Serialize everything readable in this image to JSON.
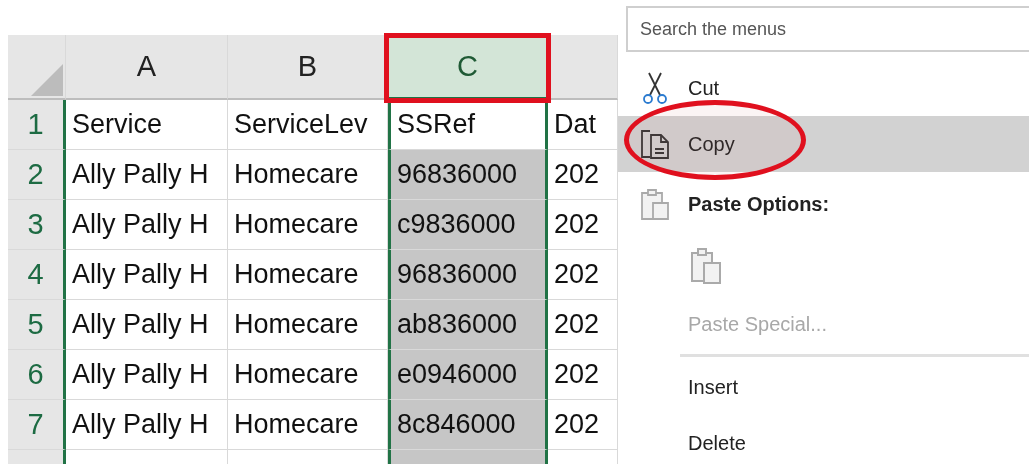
{
  "sheet": {
    "columns": [
      {
        "letter": "A",
        "selected": false
      },
      {
        "letter": "B",
        "selected": false
      },
      {
        "letter": "C",
        "selected": true,
        "annotated": true
      },
      {
        "selected": false
      }
    ],
    "rows": [
      {
        "number": "1",
        "active": true,
        "cells": [
          "Service",
          "ServiceLev",
          "SSRef",
          "Dat"
        ]
      },
      {
        "number": "2",
        "active": false,
        "cells": [
          "Ally Pally H",
          "Homecare",
          "96836000",
          "202"
        ]
      },
      {
        "number": "3",
        "active": false,
        "cells": [
          "Ally Pally H",
          "Homecare",
          "c9836000",
          "202"
        ]
      },
      {
        "number": "4",
        "active": false,
        "cells": [
          "Ally Pally H",
          "Homecare",
          "96836000",
          "202"
        ]
      },
      {
        "number": "5",
        "active": false,
        "cells": [
          "Ally Pally H",
          "Homecare",
          "ab836000",
          "202"
        ]
      },
      {
        "number": "6",
        "active": false,
        "cells": [
          "Ally Pally H",
          "Homecare",
          "e0946000",
          "202"
        ]
      },
      {
        "number": "7",
        "active": false,
        "cells": [
          "Ally Pally H",
          "Homecare",
          "8c846000",
          "202"
        ]
      }
    ]
  },
  "context_menu": {
    "search": {
      "placeholder": "Search the menus"
    },
    "items": [
      {
        "kind": "cut",
        "label": "Cut",
        "selected": false,
        "disabled": false
      },
      {
        "kind": "copy",
        "label": "Copy",
        "selected": true,
        "disabled": false,
        "annotated": true
      },
      {
        "kind": "heading",
        "label": "Paste Options:"
      },
      {
        "kind": "paste-options"
      },
      {
        "kind": "command",
        "label": "Paste Special...",
        "selected": false,
        "disabled": true
      },
      {
        "kind": "separator"
      },
      {
        "kind": "command",
        "label": "Insert",
        "selected": false,
        "disabled": false
      },
      {
        "kind": "command",
        "label": "Delete",
        "selected": false,
        "disabled": false
      }
    ]
  }
}
